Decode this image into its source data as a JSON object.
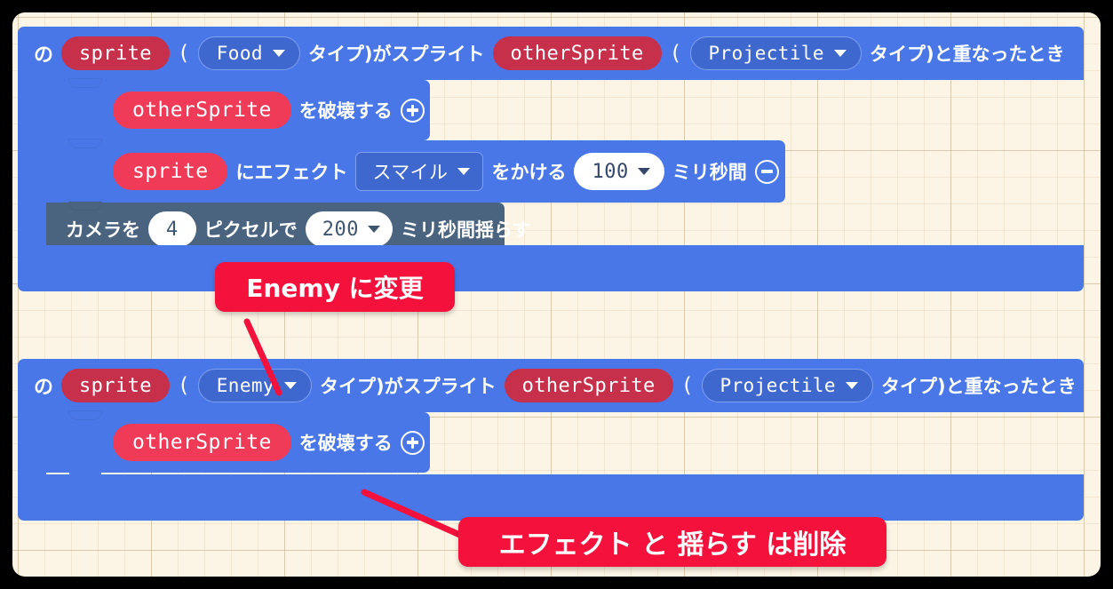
{
  "workspace": {
    "background_color": "#fcf4e4",
    "grid": true,
    "block_colors": {
      "event_blue": "#4a77e8",
      "camera_slate": "#4a6480",
      "variable_red_dark": "#c6304a",
      "variable_red_light": "#ef3b57",
      "dropdown_blue": "#3f68cf",
      "callout_red": "#f4113c"
    }
  },
  "stacks": [
    {
      "id": "stack-food",
      "header": {
        "prefix": "の",
        "sprite_var": "sprite",
        "open_paren": "(",
        "kind_dropdown": "Food",
        "mid_text": "タイプ)がスプライト",
        "other_var": "otherSprite",
        "open_paren2": "(",
        "other_dropdown": "Projectile",
        "suffix": "タイプ)と重なったとき"
      },
      "statements": [
        {
          "id": "destroy-1",
          "type": "destroy",
          "var": "otherSprite",
          "text": "を破壊する",
          "icon": "plus-circle-icon"
        },
        {
          "id": "effect-1",
          "type": "effect",
          "var": "sprite",
          "text_1": "にエフェクト",
          "effect_dropdown": "スマイル",
          "text_2": "をかける",
          "duration": "100",
          "text_3": "ミリ秒間",
          "icon": "minus-circle-icon"
        },
        {
          "id": "camera-shake-1",
          "type": "camera-shake",
          "text_1": "カメラを",
          "amount": "4",
          "text_2": "ピクセルで",
          "duration": "200",
          "text_3": "ミリ秒間揺らす"
        }
      ]
    },
    {
      "id": "stack-enemy",
      "header": {
        "prefix": "の",
        "sprite_var": "sprite",
        "open_paren": "(",
        "kind_dropdown": "Enemy",
        "mid_text": "タイプ)がスプライト",
        "other_var": "otherSprite",
        "open_paren2": "(",
        "other_dropdown": "Projectile",
        "suffix": "タイプ)と重なったとき"
      },
      "statements": [
        {
          "id": "destroy-2",
          "type": "destroy",
          "var": "otherSprite",
          "text": "を破壊する",
          "icon": "plus-circle-icon"
        }
      ]
    }
  ],
  "annotations": [
    {
      "id": "annotation-change-enemy",
      "label": "Enemy に変更",
      "color": "#f4113c"
    },
    {
      "id": "annotation-delete-effect-shake",
      "label": "エフェクト と 揺らす は削除",
      "color": "#f4113c"
    }
  ]
}
